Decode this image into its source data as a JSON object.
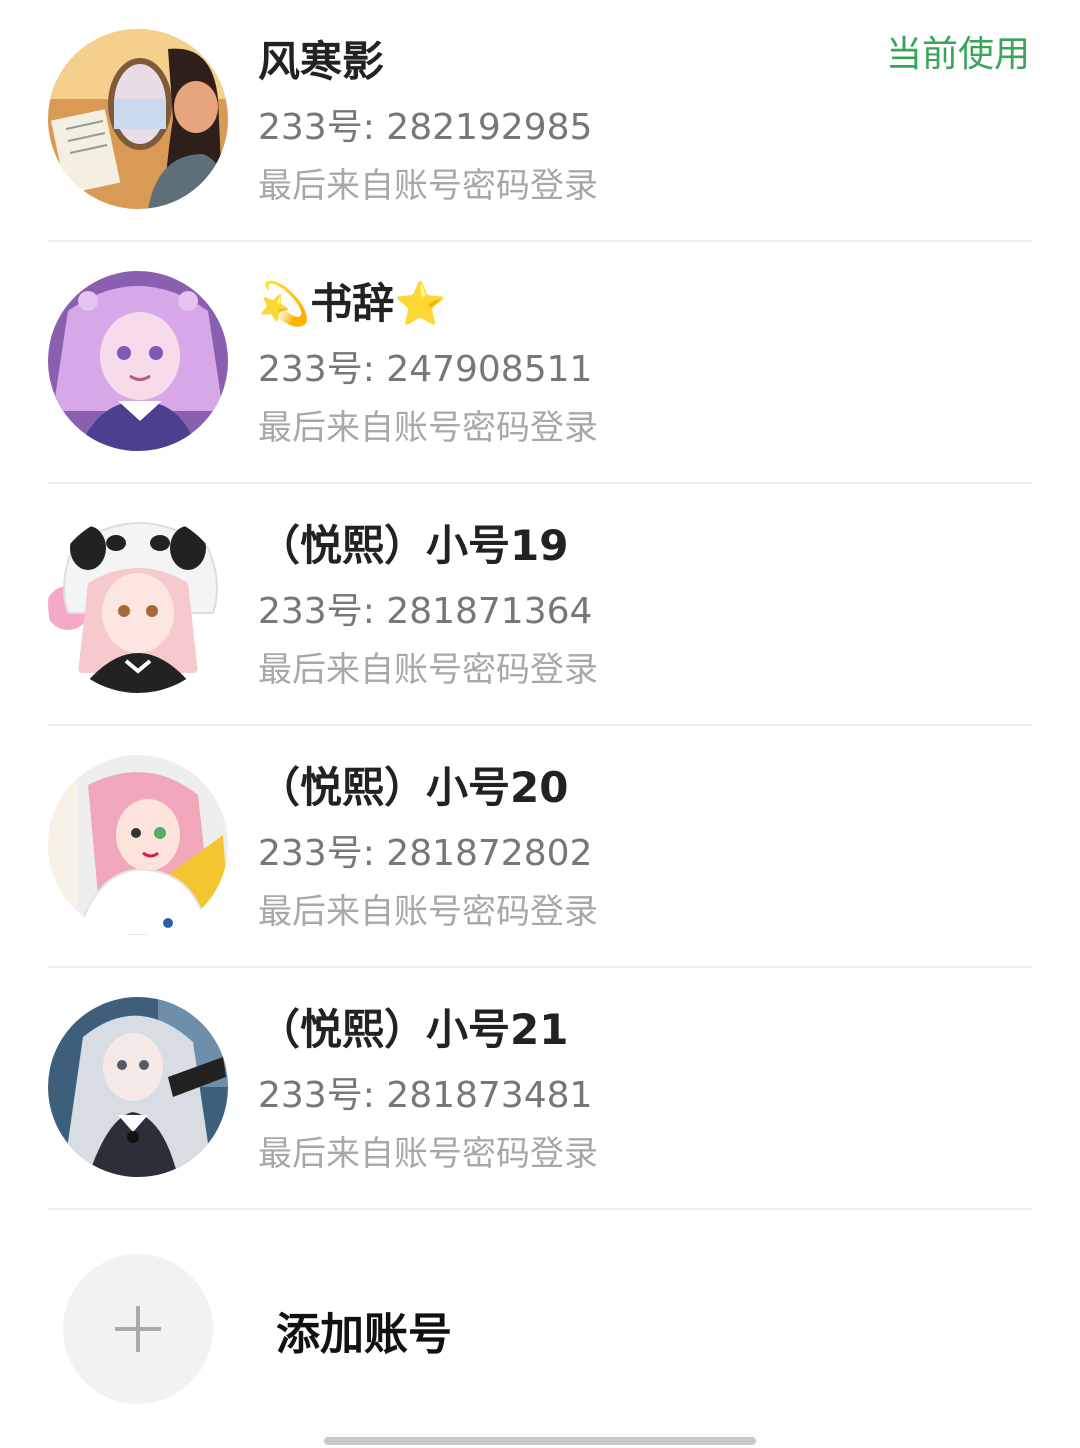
{
  "accounts": [
    {
      "name": "风寒影",
      "id_text": "233号: 282192985",
      "source": "最后来自账号密码登录",
      "current_label": "当前使用"
    },
    {
      "name": "💫书辞⭐",
      "id_text": "233号: 247908511",
      "source": "最后来自账号密码登录"
    },
    {
      "name": "（悦熙）小号19",
      "id_text": "233号: 281871364",
      "source": "最后来自账号密码登录"
    },
    {
      "name": "（悦熙）小号20",
      "id_text": "233号: 281872802",
      "source": "最后来自账号密码登录"
    },
    {
      "name": "（悦熙）小号21",
      "id_text": "233号: 281873481",
      "source": "最后来自账号密码登录"
    }
  ],
  "add_account": {
    "label": "添加账号",
    "icon": "plus-icon"
  },
  "colors": {
    "current_badge": "#3aa55a",
    "divider": "#ececec",
    "add_circle_bg": "#f2f2f2"
  }
}
